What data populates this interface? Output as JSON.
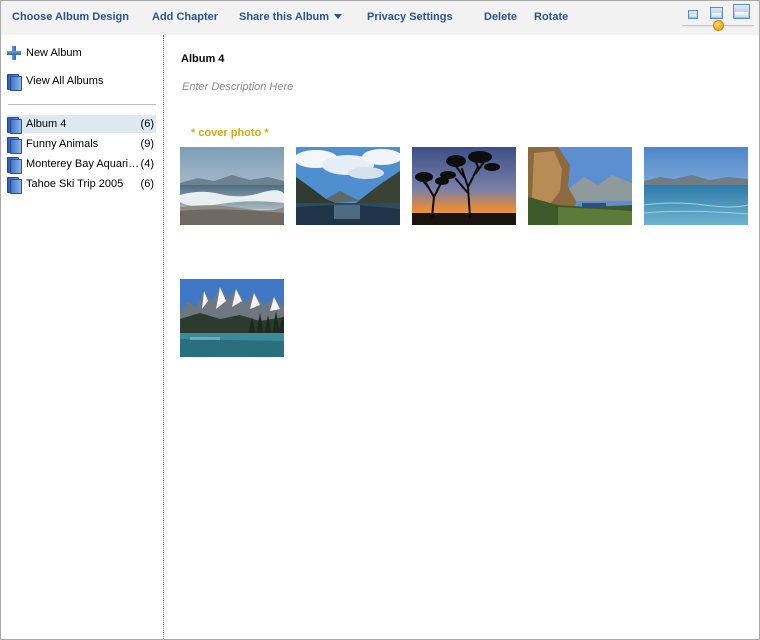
{
  "toolbar": {
    "items": [
      {
        "label": "Choose Album Design"
      },
      {
        "label": "Add Chapter"
      },
      {
        "label": "Share this Album"
      },
      {
        "label": "Privacy Settings"
      },
      {
        "label": "Delete"
      },
      {
        "label": "Rotate"
      }
    ],
    "thumbnail_size": {
      "icons": [
        "small-thumbnail-icon",
        "medium-thumbnail-icon",
        "large-thumbnail-icon"
      ],
      "slider_level": 0.5,
      "knob_color": "#f0a81a"
    }
  },
  "sidebar": {
    "actions": [
      {
        "label": "New Album",
        "icon": "plus-icon"
      },
      {
        "label": "View All Albums",
        "icon": "book-icon"
      }
    ],
    "albums": [
      {
        "name": "Album 4",
        "count": "(6)",
        "selected": true
      },
      {
        "name": "Funny Animals",
        "count": "(9)",
        "selected": false
      },
      {
        "name": "Monterey Bay Aquarium",
        "count": "(4)",
        "selected": false
      },
      {
        "name": "Tahoe Ski Trip 2005",
        "count": "(6)",
        "selected": false
      }
    ]
  },
  "main": {
    "title": "Album 4",
    "description_placeholder": "Enter Description Here",
    "cover_label": "* cover photo *",
    "photos": [
      {
        "subject": "ocean-waves-beach"
      },
      {
        "subject": "mountain-lake-clouds"
      },
      {
        "subject": "tree-silhouette-sunset"
      },
      {
        "subject": "coastal-cliffs"
      },
      {
        "subject": "blue-sea-horizon"
      },
      {
        "subject": "alpine-lake-peaks"
      }
    ]
  },
  "colors": {
    "toolbar_link": "#28548f",
    "cover_label": "#d9a70e",
    "selected_row": "#dde8f1"
  }
}
